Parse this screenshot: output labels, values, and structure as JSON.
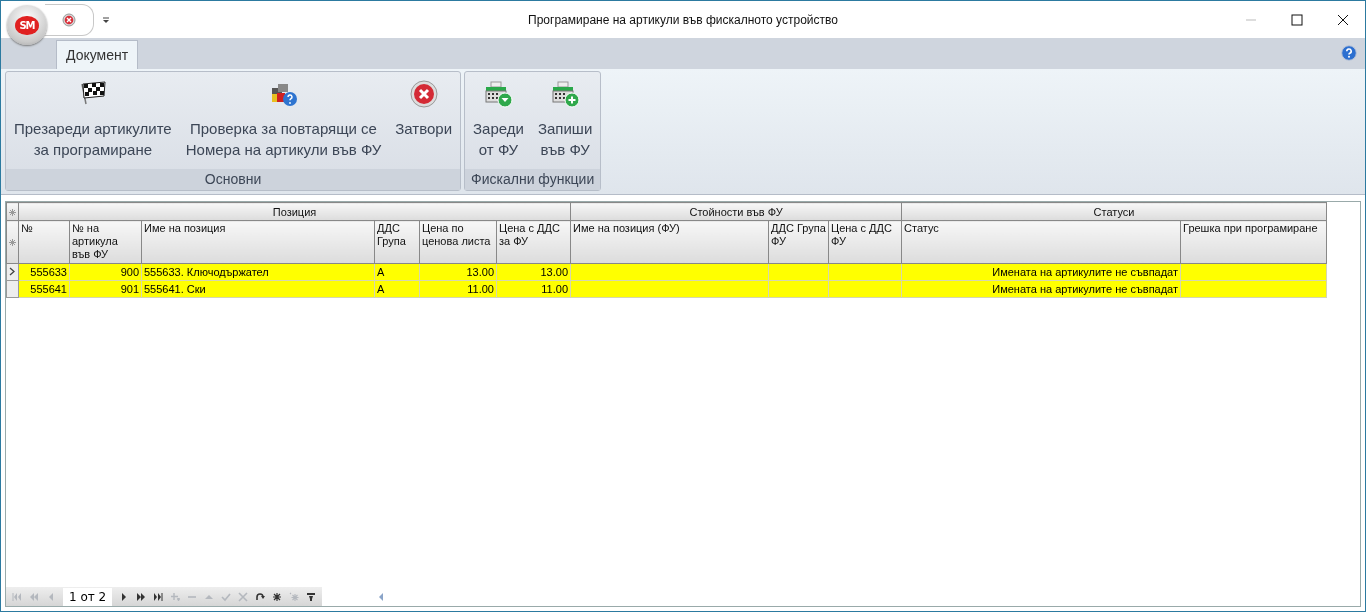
{
  "window": {
    "title": "Програмиране на артикули във фискалното устройство"
  },
  "app_button": {
    "label": "SM"
  },
  "tabs": [
    {
      "label": "Документ",
      "selected": true
    }
  ],
  "ribbon_groups": [
    {
      "label": "Основни",
      "buttons": [
        {
          "label": "Презареди артикулите\nза програмиране",
          "kind": "flag"
        },
        {
          "label": "Проверка за повтарящи се\nНомера на артикули във ФУ",
          "kind": "check"
        },
        {
          "label": "Затвори",
          "kind": "close"
        }
      ]
    },
    {
      "label": "Фискални функции",
      "buttons": [
        {
          "label": "Зареди\nот ФУ",
          "kind": "load"
        },
        {
          "label": "Запиши\nвъв ФУ",
          "kind": "save"
        }
      ]
    }
  ],
  "table": {
    "bands": [
      {
        "label": "Позиция",
        "columns": [
          "№",
          "№ на артикула във ФУ",
          "Име на позиция",
          "ДДС Група",
          "Цена по ценова листа",
          "Цена с ДДС за ФУ"
        ]
      },
      {
        "label": "Стойности във ФУ",
        "columns": [
          "Име на позиция (ФУ)",
          "ДДС Група ФУ",
          "Цена с ДДС ФУ"
        ]
      },
      {
        "label": "Статуси",
        "columns": [
          "Статус",
          "Грешка при програмиране"
        ]
      }
    ],
    "rows": [
      {
        "selected": true,
        "cells": [
          "555633",
          "900",
          "555633. Ключодържател",
          "A",
          "13.00",
          "13.00",
          "",
          "",
          "",
          "Имената на артикулите не съвпадат",
          ""
        ]
      },
      {
        "selected": false,
        "cells": [
          "555641",
          "901",
          "555641. Ски",
          "A",
          "11.00",
          "11.00",
          "",
          "",
          "",
          "Имената на артикулите не съвпадат",
          ""
        ]
      }
    ]
  },
  "navigator": {
    "page": "1 от 2",
    "buttons": [
      {
        "kind": "first",
        "disabled": true
      },
      {
        "kind": "prev-page",
        "disabled": true
      },
      {
        "kind": "prev",
        "disabled": true
      },
      {
        "kind": "next",
        "disabled": false
      },
      {
        "kind": "next-page",
        "disabled": false
      },
      {
        "kind": "last",
        "disabled": false
      },
      {
        "kind": "append",
        "disabled": true
      },
      {
        "kind": "remove",
        "disabled": true
      },
      {
        "kind": "up",
        "disabled": true
      },
      {
        "kind": "apply",
        "disabled": true
      },
      {
        "kind": "cancel",
        "disabled": true
      },
      {
        "kind": "refresh",
        "disabled": false
      },
      {
        "kind": "mark",
        "disabled": false
      },
      {
        "kind": "mark-all",
        "disabled": true
      },
      {
        "kind": "filter",
        "disabled": false
      }
    ]
  }
}
